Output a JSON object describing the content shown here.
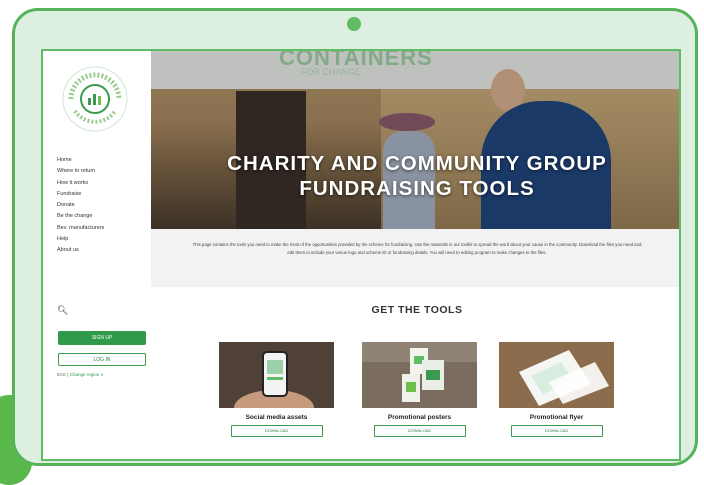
{
  "sidebar": {
    "nav_items": [
      "Home",
      "Where to return",
      "How it works",
      "Fundraise",
      "Donate",
      "Be the change",
      "Bev. manufacturers",
      "Help",
      "About us"
    ],
    "signup_label": "SIGN UP",
    "login_label": "LOG IN",
    "lang_prefix": "EnG |",
    "lang_link": "Change region ∨"
  },
  "hero": {
    "logo_text": "CONTAINERS",
    "logo_sub": "FOR CHANGE",
    "title_line1": "CHARITY AND COMMUNITY GROUP",
    "title_line2": "FUNDRAISING TOOLS"
  },
  "intro": {
    "text": "This page contains the tools you need to make the most of the opportunities provided by the scheme for fundraising. Use the materials in our toolkit to spread the word about your cause in the community. Download the files you need and edit them to include your venue logo and scheme ID or fundraising details. You will need to editing program to make changes to the files."
  },
  "tools": {
    "title": "GET THE TOOLS",
    "cards": [
      {
        "label": "Social media assets",
        "button": "DOWNLOAD"
      },
      {
        "label": "Promotional posters",
        "button": "DOWNLOAD"
      },
      {
        "label": "Promotional flyer",
        "button": "DOWNLOAD"
      }
    ]
  },
  "colors": {
    "accent_green": "#2f9a49",
    "frame_green": "#56b35a",
    "frame_fill": "#dcefe0"
  }
}
